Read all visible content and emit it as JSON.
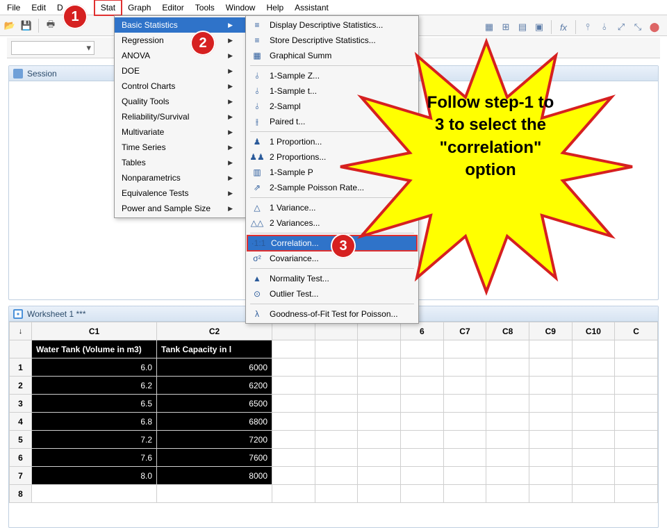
{
  "menu": {
    "file": "File",
    "edit": "Edit",
    "data_partial": "D",
    "stat": "Stat",
    "graph": "Graph",
    "editor": "Editor",
    "tools": "Tools",
    "window": "Window",
    "help": "Help",
    "assistant": "Assistant"
  },
  "stat_menu": {
    "basic_statistics": "Basic Statistics",
    "regression": "Regression",
    "anova": "ANOVA",
    "doe": "DOE",
    "control_charts": "Control Charts",
    "quality_tools": "Quality Tools",
    "reliability_survival": "Reliability/Survival",
    "multivariate": "Multivariate",
    "time_series": "Time Series",
    "tables": "Tables",
    "nonparametrics": "Nonparametrics",
    "equivalence_tests": "Equivalence Tests",
    "power_sample_size": "Power and Sample Size"
  },
  "basic_stats_menu": {
    "display_descriptive": "Display Descriptive Statistics...",
    "store_descriptive": "Store Descriptive Statistics...",
    "graphical_summary": "Graphical Summ",
    "one_sample_z": "1-Sample Z...",
    "one_sample_t": "1-Sample t...",
    "two_sample": "2-Sampl",
    "paired_t": "Paired t...",
    "one_proportion": "1 Proportion...",
    "two_proportions": "2 Proportions...",
    "one_sample_poisson": "1-Sample P",
    "two_sample_poisson": "2-Sample Poisson Rate...",
    "one_variance": "1 Variance...",
    "two_variances": "2 Variances...",
    "correlation": "Correlation...",
    "covariance": "Covariance...",
    "normality_test": "Normality Test...",
    "outlier_test": "Outlier Test...",
    "goodness_of_fit": "Goodness-of-Fit Test for Poisson..."
  },
  "session": {
    "title": "Session"
  },
  "worksheet": {
    "title": "Worksheet 1 ***",
    "arrow": "↓",
    "columns": [
      "C1",
      "C2",
      "",
      "",
      "",
      "6",
      "C7",
      "C8",
      "C9",
      "C10",
      "C"
    ],
    "headers": {
      "c1": "Water Tank (Volume in m3)",
      "c2": "Tank Capacity in l"
    },
    "rows": [
      {
        "n": "1",
        "c1": "6.0",
        "c2": "6000"
      },
      {
        "n": "2",
        "c1": "6.2",
        "c2": "6200"
      },
      {
        "n": "3",
        "c1": "6.5",
        "c2": "6500"
      },
      {
        "n": "4",
        "c1": "6.8",
        "c2": "6800"
      },
      {
        "n": "5",
        "c1": "7.2",
        "c2": "7200"
      },
      {
        "n": "6",
        "c1": "7.6",
        "c2": "7600"
      },
      {
        "n": "7",
        "c1": "8.0",
        "c2": "8000"
      },
      {
        "n": "8",
        "c1": "",
        "c2": ""
      }
    ]
  },
  "annotations": {
    "badge1": "1",
    "badge2": "2",
    "badge3": "3",
    "star_line1": "Follow step-1 to",
    "star_line2": "3 to select the",
    "star_line3": "\"correlation\"",
    "star_line4": "option"
  },
  "icons": {
    "stats_ico": "≡",
    "graph_ico": "▦",
    "z_ico": "⫰",
    "t_ico": "⫰",
    "paired_ico": "⫲",
    "prop_ico": "♟",
    "props_ico": "♟♟",
    "bar_ico": "▥",
    "rate_ico": "⇗",
    "var_ico": "△",
    "vars_ico": "△△",
    "corr_ico": "·1:1",
    "cov_ico": "σ²",
    "norm_ico": "▲",
    "outlier_ico": "⊙",
    "gof_ico": "λ"
  }
}
